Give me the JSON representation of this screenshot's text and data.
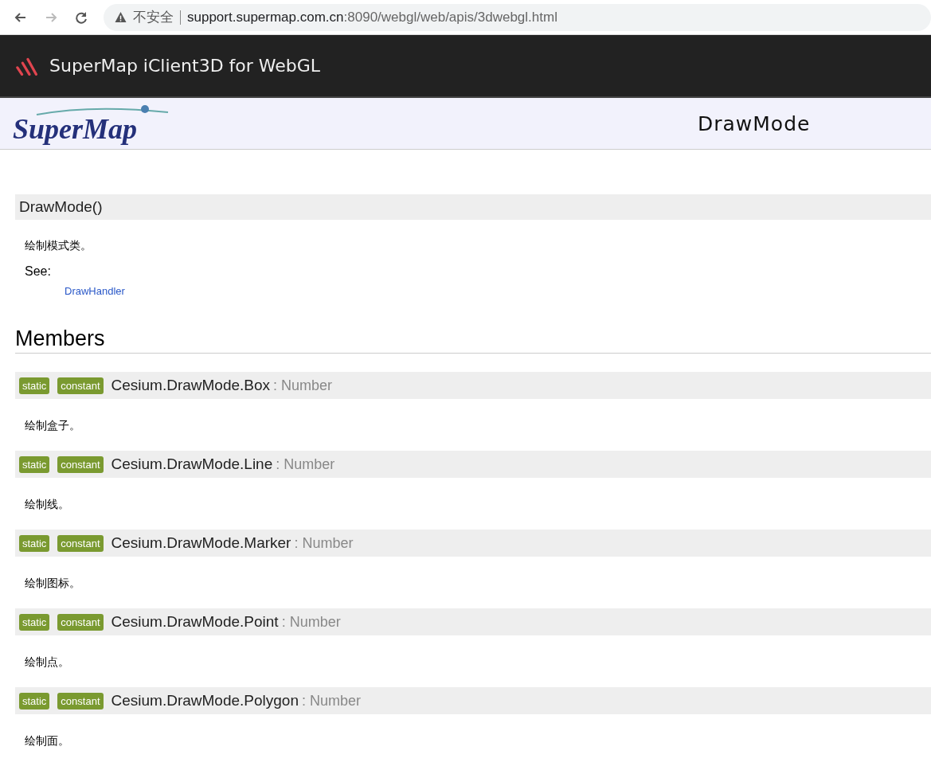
{
  "browser": {
    "security_label": "不安全",
    "url_host": "support.supermap.com.cn",
    "url_path": ":8090/webgl/web/apis/3dwebgl.html"
  },
  "header": {
    "title": "SuperMap iClient3D for WebGL"
  },
  "banner": {
    "logo_text": "SuperMap",
    "page_title": "DrawMode"
  },
  "constructor": {
    "signature": "DrawMode()",
    "description": "绘制模式类。",
    "see_label": "See:",
    "see_link": "DrawHandler"
  },
  "members_heading": "Members",
  "members": [
    {
      "tags": [
        "static",
        "constant"
      ],
      "name": "Cesium.DrawMode.Box",
      "type": ": Number",
      "description": "绘制盒子。"
    },
    {
      "tags": [
        "static",
        "constant"
      ],
      "name": "Cesium.DrawMode.Line",
      "type": ": Number",
      "description": "绘制线。"
    },
    {
      "tags": [
        "static",
        "constant"
      ],
      "name": "Cesium.DrawMode.Marker",
      "type": ": Number",
      "description": "绘制图标。"
    },
    {
      "tags": [
        "static",
        "constant"
      ],
      "name": "Cesium.DrawMode.Point",
      "type": ": Number",
      "description": "绘制点。"
    },
    {
      "tags": [
        "static",
        "constant"
      ],
      "name": "Cesium.DrawMode.Polygon",
      "type": ": Number",
      "description": "绘制面。"
    }
  ]
}
